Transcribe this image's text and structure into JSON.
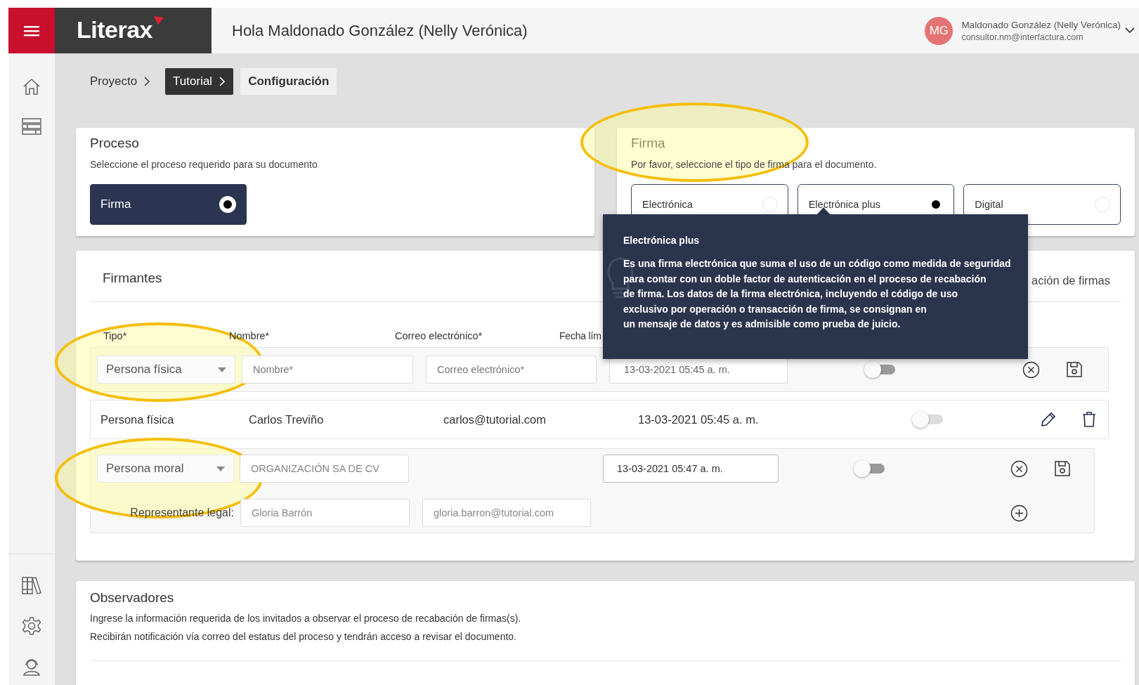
{
  "header": {
    "logo": "Literax",
    "greeting": "Hola Maldonado González (Nelly Verónica)",
    "user": {
      "initials": "MG",
      "name": "Maldonado González (Nelly Verónica)",
      "email": "consultor.nm@interfactura.com"
    }
  },
  "breadcrumb": [
    {
      "label": "Proyecto",
      "kind": "link"
    },
    {
      "label": "Tutorial",
      "kind": "active"
    },
    {
      "label": "Configuración",
      "kind": "current"
    }
  ],
  "proceso": {
    "title": "Proceso",
    "subtitle": "Seleccione el proceso requerido para su documento",
    "options": [
      {
        "label": "Firma",
        "selected": true
      }
    ]
  },
  "firma": {
    "title": "Firma",
    "subtitle": "Por favor, seleccione el tipo de firma para el documento.",
    "options": [
      {
        "label": "Electrónica",
        "selected": false
      },
      {
        "label": "Electrónica plus",
        "selected": true
      },
      {
        "label": "Digital",
        "selected": false
      }
    ]
  },
  "tooltip": {
    "title": "Electrónica plus",
    "lines": [
      "Es una firma electrónica que suma el uso de un código como medida de seguridad",
      "para contar con un doble factor de autenticación en el proceso de recabación",
      "de firma. Los datos de la firma electrónica, incluyendo el código de uso",
      "exclusivo por operación o transacción de firma, se consignan en",
      "un mensaje de datos y es admisible como prueba de juicio."
    ]
  },
  "firmantes": {
    "title": "Firmantes",
    "side_text": "ación de firmas",
    "columns": [
      "Tipo*",
      "Nombre*",
      "Correo electrónico*",
      "Fecha lím"
    ],
    "rows": [
      {
        "kind": "edit",
        "tipo": "Persona física",
        "nombre_placeholder": "Nombre*",
        "correo_placeholder": "Correo electrónico*",
        "fecha": "13-03-2021 05:45 a. m.",
        "on": false
      },
      {
        "kind": "display",
        "tipo": "Persona física",
        "nombre": "Carlos Treviño",
        "correo": "carlos@tutorial.com",
        "fecha": "13-03-2021 05:45 a. m.",
        "on": false
      },
      {
        "kind": "moral",
        "tipo": "Persona moral",
        "nombre": "ORGANIZACIÓN SA DE CV",
        "fecha": "13-03-2021 05:47 a. m.",
        "on": false,
        "representante": {
          "label": "Representante legal:",
          "nombre": "Gloria Barrón",
          "correo": "gloria.barron@tutorial.com"
        }
      }
    ]
  },
  "observadores": {
    "title": "Observadores",
    "lines": [
      "Ingrese la información requerida de los invitados a observar el proceso de recabación de firmas(s).",
      "Recibirán notificación vía correo del estatus del proceso y tendrán acceso a revisar el documento."
    ]
  }
}
